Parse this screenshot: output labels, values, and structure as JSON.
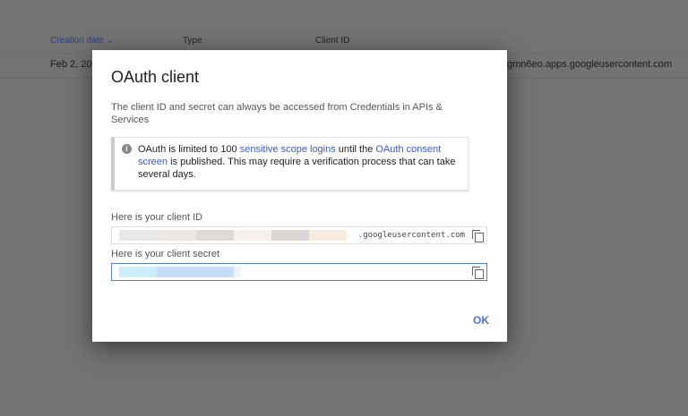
{
  "table": {
    "headers": [
      "Creation date",
      "Type",
      "Client ID"
    ],
    "sort_icon": "chevron-down-icon",
    "row": {
      "date": "Feb 2, 201",
      "client_id": "gmn6eo.apps.googleusercontent.com"
    }
  },
  "dialog": {
    "title": "OAuth client",
    "description": "The client ID and secret can always be accessed from Credentials in APIs & Services",
    "info": {
      "icon": "info-icon",
      "t1": "OAuth is limited to 100 ",
      "link1": "sensitive scope logins",
      "t2": " until the ",
      "link2": "OAuth consent screen",
      "t3": " is published. This may require a verification process that can take several days."
    },
    "client_id_label": "Here is your client ID",
    "client_id_suffix": ".googleusercontent.com",
    "client_secret_label": "Here is your client secret",
    "ok_label": "OK"
  },
  "colors": {
    "link": "#3b5bc6",
    "accent": "#4a72d8"
  }
}
